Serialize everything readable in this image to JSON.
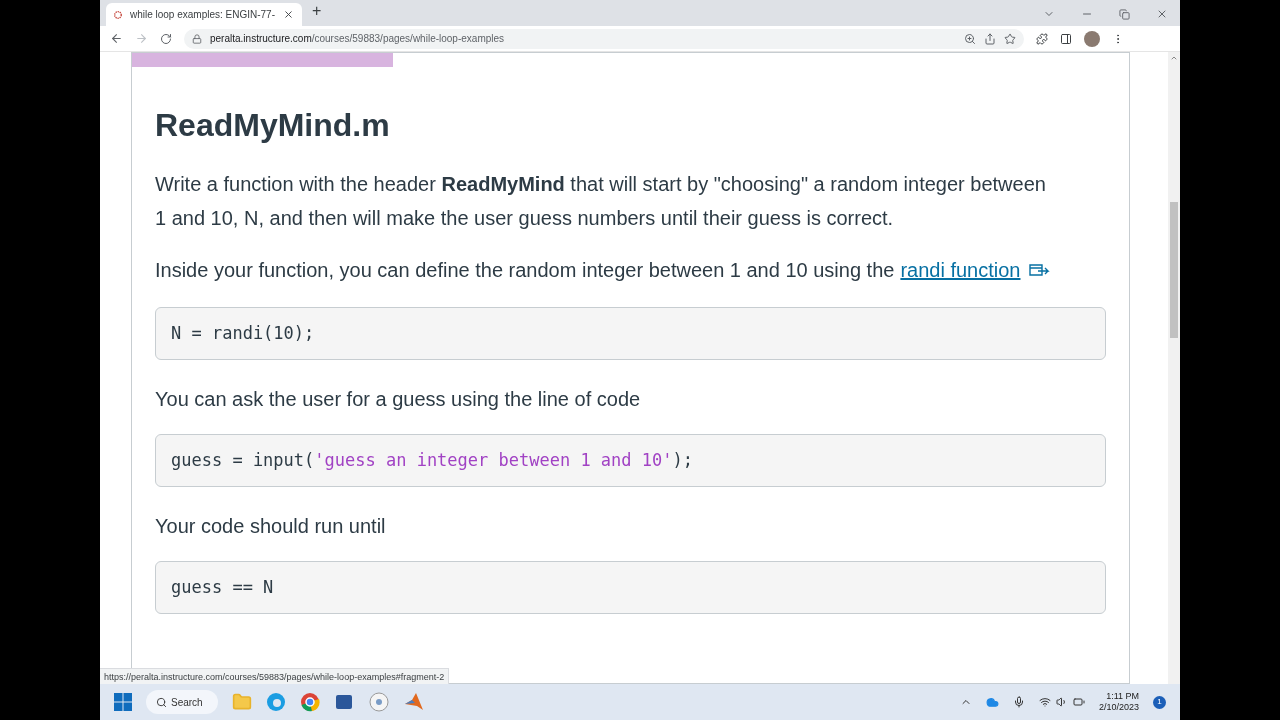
{
  "browser": {
    "tab_title": "while loop examples: ENGIN-77-",
    "new_tab": "+",
    "url_domain": "peralta.instructure.com",
    "url_path": "/courses/59883/pages/while-loop-examples"
  },
  "page": {
    "heading": "ReadMyMind.m",
    "blocks": [
      {
        "kind": "paragraph",
        "text": "Write a function with the header **ReadMyMind** that will start by \"choosing\" a random integer between 1 and 10, N, and then will make the user guess numbers until their guess is correct."
      },
      {
        "kind": "link_paragraph",
        "text": "Inside your function, you can define the random integer between 1 and 10 using the",
        "link": "randi function"
      },
      {
        "kind": "code",
        "parts": [
          {
            "kind": "plain",
            "text": "N = randi(10);"
          }
        ]
      },
      {
        "kind": "paragraph",
        "text": "You can ask the user for a guess using the line of code"
      },
      {
        "kind": "code",
        "parts": [
          {
            "kind": "plain",
            "text": "guess = input("
          },
          {
            "kind": "string",
            "text": "'guess an integer between 1 and 10'"
          },
          {
            "kind": "plain",
            "text": ");"
          }
        ]
      },
      {
        "kind": "paragraph",
        "text": "Your code should run until"
      },
      {
        "kind": "code",
        "parts": [
          {
            "kind": "plain",
            "text": "guess == N"
          }
        ]
      }
    ]
  },
  "status_url": "https://peralta.instructure.com/courses/59883/pages/while-loop-examples#fragment-2",
  "taskbar": {
    "search": "Search",
    "time": "1:11 PM",
    "date": "2/10/2023",
    "notifications": "1"
  }
}
